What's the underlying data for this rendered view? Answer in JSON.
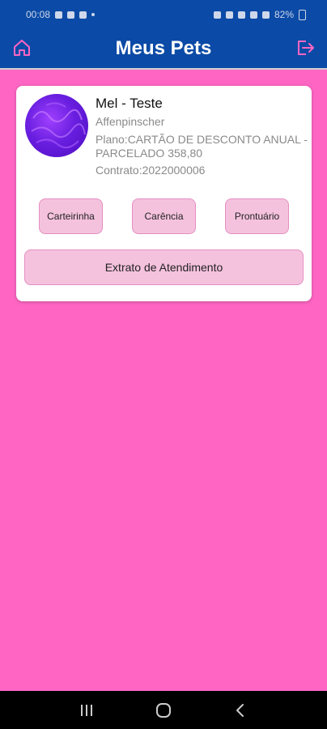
{
  "status_bar": {
    "time": "00:08",
    "battery": "82%"
  },
  "app_bar": {
    "title": "Meus Pets",
    "home_icon": "home-icon",
    "logout_icon": "logout-icon",
    "background_color": "#0b4aa6",
    "title_color": "#ffffff",
    "icon_color": "#ff66c4"
  },
  "page": {
    "background_color": "#ff66c4"
  },
  "pets": [
    {
      "name": "Mel - Teste",
      "breed": "Affenpinscher",
      "plan": "Plano:CARTÃO DE DESCONTO ANUAL - PARCELADO 358,80",
      "contract": "Contrato:2022000006",
      "actions": {
        "carteirinha": "Carteirinha",
        "carencia": "Carência",
        "prontuario": "Prontuário",
        "extrato": "Extrato de Atendimento"
      }
    }
  ],
  "nav_bar": {
    "recents_icon": "recents-icon",
    "home_icon": "nav-home-icon",
    "back_icon": "back-icon"
  }
}
